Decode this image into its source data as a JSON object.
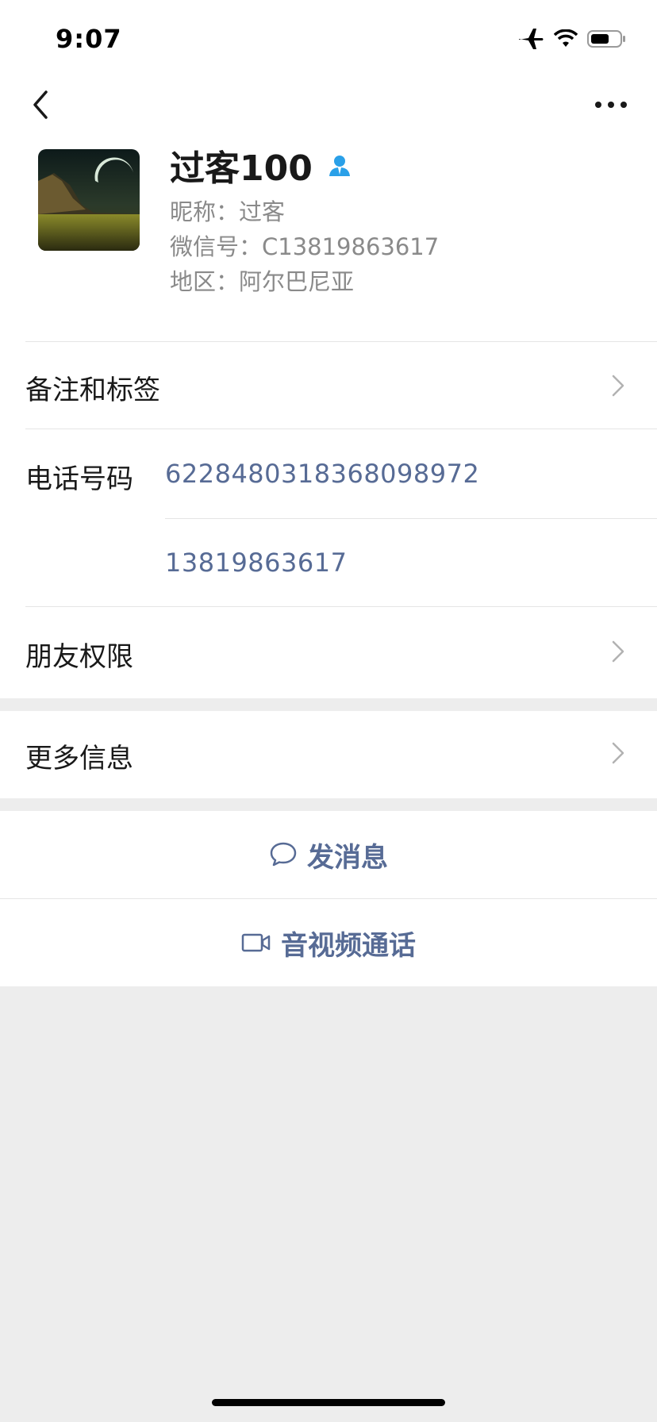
{
  "status_bar": {
    "time": "9:07"
  },
  "profile": {
    "display_name": "过客100",
    "nickname": "昵称：过客",
    "wechat_id": "微信号：C13819863617",
    "region": "地区：阿尔巴尼亚"
  },
  "rows": {
    "remarks_tags": "备注和标签",
    "phone_label": "电话号码",
    "phone_numbers": [
      "6228480318368098972",
      "13819863617"
    ],
    "friend_permissions": "朋友权限",
    "more_info": "更多信息"
  },
  "actions": {
    "send_message": "发消息",
    "av_call": "音视频通话"
  },
  "colors": {
    "link": "#576b95",
    "background": "#ededed",
    "badge": "#2aa0e8"
  },
  "icons": [
    "airplane-icon",
    "wifi-icon",
    "battery-icon",
    "back-icon",
    "more-icon",
    "contact-badge-icon",
    "chevron-right-icon",
    "chat-bubble-icon",
    "video-call-icon"
  ]
}
